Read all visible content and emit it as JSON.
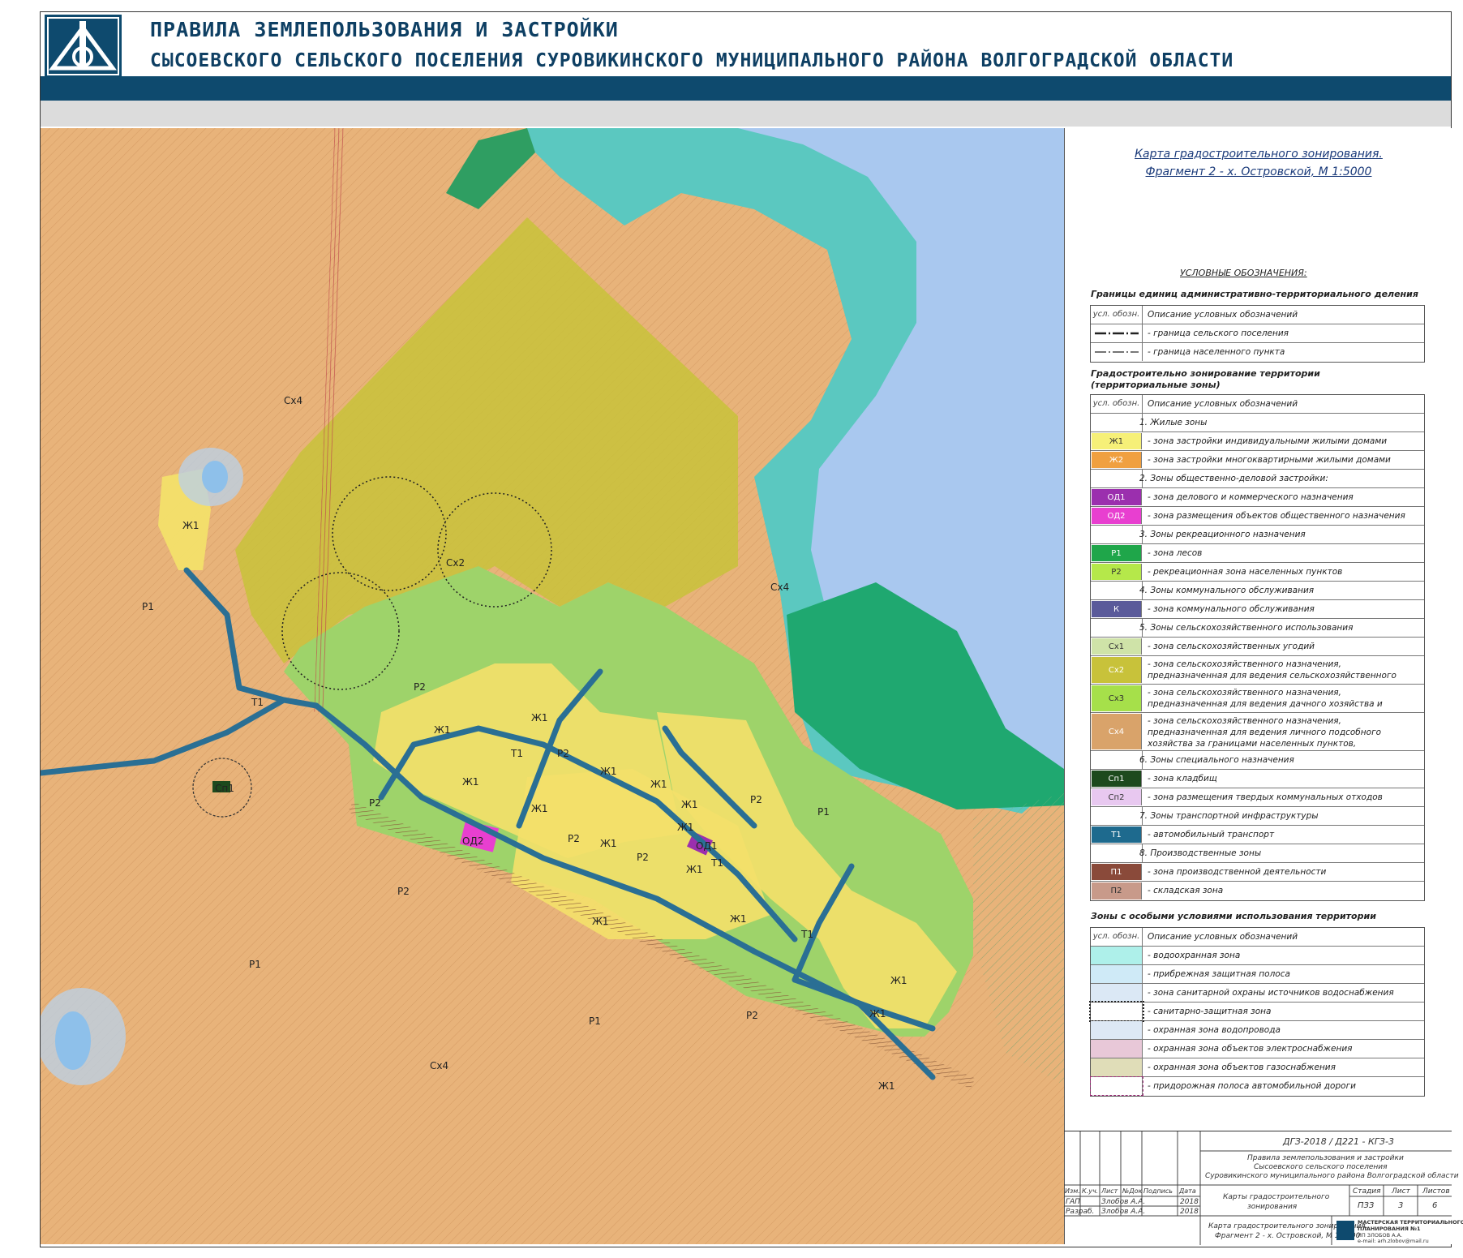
{
  "header": {
    "title_line1": "ПРАВИЛА ЗЕМЛЕПОЛЬЗОВАНИЯ И ЗАСТРОЙКИ",
    "title_line2": "СЫСОЕВСКОГО СЕЛЬСКОГО ПОСЕЛЕНИЯ СУРОВИКИНСКОГО МУНИЦИПАЛЬНОГО РАЙОНА ВОЛГОГРАДСКОЙ ОБЛАСТИ"
  },
  "colors": {
    "brand": "#0e4a6e",
    "agri": "#e8b37a",
    "water": "#a9c8ef",
    "forest": "#3cb371",
    "water_protection": "#5bc8c0",
    "residential": "#f3e06a",
    "recreation": "#9ed36a",
    "agri_zone2": "#c8c23a",
    "road": "#2a6f94",
    "od1": "#9b2fae",
    "od2": "#e83fd0"
  },
  "map": {
    "labels": {
      "cx4_a": "Сх4",
      "cx4_b": "Сх4",
      "cx4_c": "Сх4",
      "cx2": "Сх2",
      "p1_a": "Р1",
      "p1_b": "Р1",
      "p1_c": "Р1",
      "p1_d": "Р1",
      "p2_a": "Р2",
      "p2_b": "Р2",
      "p2_c": "Р2",
      "p2_d": "Р2",
      "p2_e": "Р2",
      "p2_f": "Р2",
      "p2_g": "Р2",
      "p2_h": "Р2",
      "zh1_a": "Ж1",
      "zh1_b": "Ж1",
      "zh1_c": "Ж1",
      "zh1_d": "Ж1",
      "zh1_e": "Ж1",
      "zh1_f": "Ж1",
      "zh1_g": "Ж1",
      "zh1_h": "Ж1",
      "zh1_i": "Ж1",
      "zh1_j": "Ж1",
      "zh1_k": "Ж1",
      "zh1_l": "Ж1",
      "zh1_m": "Ж1",
      "zh1_n": "Ж1",
      "zh1_o": "Ж1",
      "zh1_p": "Ж1",
      "t1_a": "Т1",
      "t1_b": "Т1",
      "t1_c": "Т1",
      "t1_d": "Т1",
      "od1": "ОД1",
      "od2": "ОД2",
      "sp1": "Сп1"
    }
  },
  "legend": {
    "title_line1": "Карта градостроительного зонирования.",
    "title_line2": "Фрагмент 2 - х. Островской, М 1:5000",
    "conventions": "УСЛОВНЫЕ ОБОЗНАЧЕНИЯ:",
    "section1": "Границы единиц административно-территориального деления",
    "col_sym": "усл. обозн.",
    "col_desc": "Описание условных обозначений",
    "boundaries": [
      "- граница сельского поселения",
      "- граница населенного пункта"
    ],
    "section2_line1": "Градостроительно зонирование территории",
    "section2_line2": "(территориальные зоны)",
    "zones": [
      {
        "sym": "",
        "desc": "1. Жилые зоны",
        "color": "#ffffff"
      },
      {
        "sym": "Ж1",
        "desc": "- зона застройки индивидуальными жилыми домами",
        "color": "#f6f078"
      },
      {
        "sym": "Ж2",
        "desc": "- зона застройки многоквартирными жилыми домами",
        "color": "#f0a040"
      },
      {
        "sym": "",
        "desc": "2. Зоны общественно-деловой застройки:",
        "color": "#ffffff"
      },
      {
        "sym": "ОД1",
        "desc": "- зона делового и коммерческого назначения",
        "color": "#9b2fae"
      },
      {
        "sym": "ОД2",
        "desc": "- зона размещения объектов общественного назначения",
        "color": "#e83fd0"
      },
      {
        "sym": "",
        "desc": "3. Зоны рекреационного назначения",
        "color": "#ffffff"
      },
      {
        "sym": "Р1",
        "desc": "- зона лесов",
        "color": "#1fa64a"
      },
      {
        "sym": "Р2",
        "desc": "- рекреационная зона населенных пунктов",
        "color": "#b5e84a"
      },
      {
        "sym": "",
        "desc": "4. Зоны коммунального обслуживания",
        "color": "#ffffff"
      },
      {
        "sym": "К",
        "desc": "- зона коммунального обслуживания",
        "color": "#5a5a9a"
      },
      {
        "sym": "",
        "desc": "5. Зоны сельскохозяйственного использования",
        "color": "#ffffff"
      },
      {
        "sym": "Сх1",
        "desc": "- зона сельскохозяйственных угодий",
        "color": "#cfe3a8"
      },
      {
        "sym": "Сх2",
        "desc": "- зона сельскохозяйственного назначения, предназначенная для ведения сельскохозяйственного производства",
        "color": "#c8c23a",
        "tall": 2
      },
      {
        "sym": "Сх3",
        "desc": "- зона сельскохозяйственного назначения, предназначенная для ведения дачного хозяйства и садоводства",
        "color": "#a6e04a",
        "tall": 2
      },
      {
        "sym": "Сх4",
        "desc": "- зона сельскохозяйственного назначения, предназначенная для ведения личного подсобного хозяйства за границами населенных пунктов, огородничества, сенокошения",
        "color": "#d9a36a",
        "tall": 3
      },
      {
        "sym": "",
        "desc": "6. Зоны специального назначения",
        "color": "#ffffff"
      },
      {
        "sym": "Сп1",
        "desc": "- зона кладбищ",
        "color": "#1d4a1d"
      },
      {
        "sym": "Сп2",
        "desc": "- зона размещения твердых коммунальных отходов",
        "color": "#e8c8f0"
      },
      {
        "sym": "",
        "desc": "7. Зоны транспортной инфраструктуры",
        "color": "#ffffff"
      },
      {
        "sym": "Т1",
        "desc": "- автомобильный транспорт",
        "color": "#1e6a8e"
      },
      {
        "sym": "",
        "desc": "8. Производственные зоны",
        "color": "#ffffff"
      },
      {
        "sym": "П1",
        "desc": "- зона производственной деятельности",
        "color": "#8a4a3a"
      },
      {
        "sym": "П2",
        "desc": "- складская зона",
        "color": "#c89a8a"
      }
    ],
    "section3": "Зоны с особыми условиями использования территории",
    "special": [
      {
        "desc": "- водоохранная зона",
        "color": "#aef0ea"
      },
      {
        "desc": "- прибрежная защитная полоса",
        "color": "#cfeaf7"
      },
      {
        "desc": "- зона санитарной охраны источников водоснабжения",
        "color": "#dbe8f5"
      },
      {
        "desc": "- санитарно-защитная зона",
        "color": "#ffffff"
      },
      {
        "desc": "- охранная зона водопровода",
        "color": "#dde8f5"
      },
      {
        "desc": "- охранная зона объектов электроснабжения",
        "color": "#e8c8d8"
      },
      {
        "desc": "- охранная зона объектов газоснабжения",
        "color": "#e0ddb8"
      },
      {
        "desc": "- придорожная полоса автомобильной дороги",
        "color": "#ffffff"
      }
    ]
  },
  "stamp": {
    "code": "ДГЗ-2018 / Д221 - КГЗ-3",
    "project_line1": "Правила землепользования и застройки",
    "project_line2": "Сысоевского сельского поселения",
    "project_line3": "Суровикинского муниципального района Волгоградской области",
    "cols": [
      "Изм.",
      "К.уч.",
      "Лист",
      "№Док",
      "Подпись",
      "Дата"
    ],
    "role1": "ГАП",
    "name1": "Злобов А.А.",
    "date1": "2018",
    "role2": "Разраб.",
    "name2": "Злобов А.А.",
    "date2": "2018",
    "doc_title_line1": "Карты градостроительного",
    "doc_title_line2": "зонирования",
    "stage_label": "Стадия",
    "sheet_label": "Лист",
    "sheets_label": "Листов",
    "stage": "ПЗЗ",
    "sheet": "3",
    "sheets": "6",
    "fragment_line1": "Карта градостроительного зонирования.",
    "fragment_line2": "Фрагмент 2 - х. Островской, М 1:5000",
    "org_line1": "МАСТЕРСКАЯ ТЕРРИТОРИАЛЬНОГО",
    "org_line2": "ПЛАНИРОВАНИЯ №1",
    "org_line3": "ИП ЗЛОБОВ А.А.",
    "org_line4": "e-mail: arh.zlobov@mail.ru"
  }
}
